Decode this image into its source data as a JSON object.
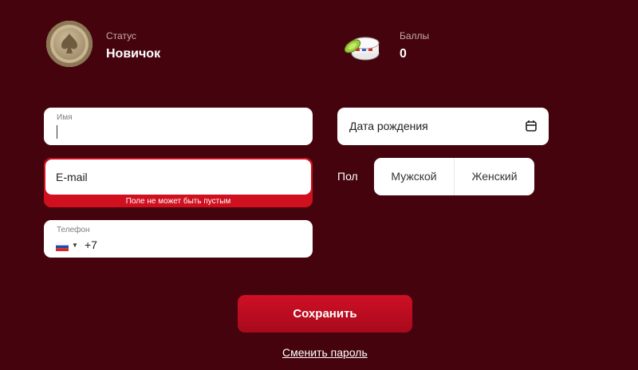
{
  "status": {
    "label": "Статус",
    "value": "Новичок",
    "icon": "poker-chip-icon"
  },
  "points": {
    "label": "Баллы",
    "value": "0",
    "icon": "coins-stack-icon"
  },
  "form": {
    "name": {
      "label": "Имя",
      "value": ""
    },
    "birthdate": {
      "placeholder": "Дата рождения",
      "icon": "calendar-icon"
    },
    "email": {
      "placeholder": "E-mail",
      "error": "Поле не может быть пустым",
      "error_color": "#d0101f"
    },
    "gender": {
      "label": "Пол",
      "options": [
        "Мужской",
        "Женский"
      ]
    },
    "phone": {
      "label": "Телефон",
      "country": "russia-flag-icon",
      "prefix": "+7"
    }
  },
  "actions": {
    "save": "Сохранить",
    "change_password": "Сменить пароль"
  },
  "colors": {
    "background": "#45040d",
    "accent": "#c80d22"
  }
}
